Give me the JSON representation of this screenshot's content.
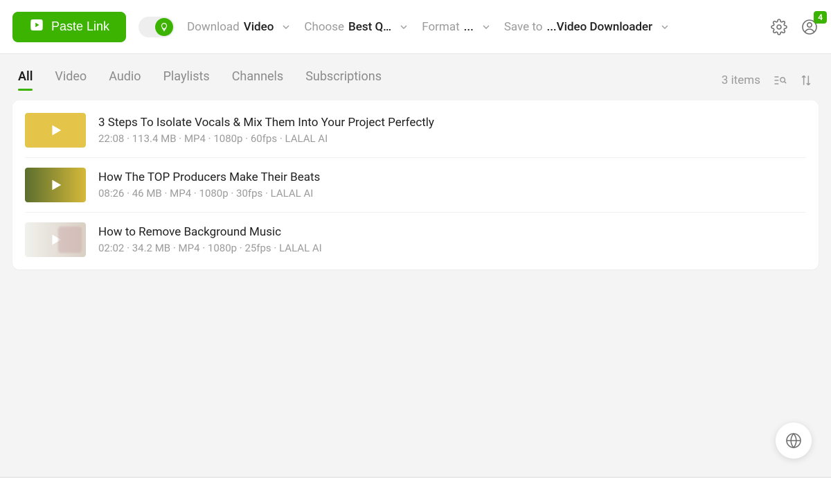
{
  "toolbar": {
    "paste_label": "Paste Link",
    "opts": {
      "download": {
        "label": "Download",
        "value": "Video"
      },
      "choose": {
        "label": "Choose",
        "value": "Best Q…"
      },
      "format": {
        "label": "Format",
        "value": "..."
      },
      "saveto": {
        "label": "Save to",
        "value": "...Video Downloader"
      }
    },
    "badge_count": "4"
  },
  "tabs": {
    "items": [
      {
        "label": "All",
        "active": true
      },
      {
        "label": "Video"
      },
      {
        "label": "Audio"
      },
      {
        "label": "Playlists"
      },
      {
        "label": "Channels"
      },
      {
        "label": "Subscriptions"
      }
    ],
    "count_text": "3 items"
  },
  "list": [
    {
      "title": "3 Steps To Isolate Vocals & Mix Them Into Your Project Perfectly",
      "duration": "22:08",
      "size": "113.4 MB",
      "container": "MP4",
      "resolution": "1080p",
      "fps": "60fps",
      "channel": "LALAL AI"
    },
    {
      "title": "How The TOP Producers Make Their Beats",
      "duration": "08:26",
      "size": "46 MB",
      "container": "MP4",
      "resolution": "1080p",
      "fps": "30fps",
      "channel": "LALAL AI"
    },
    {
      "title": "How to Remove Background Music",
      "duration": "02:02",
      "size": "34.2 MB",
      "container": "MP4",
      "resolution": "1080p",
      "fps": "25fps",
      "channel": "LALAL AI"
    }
  ]
}
